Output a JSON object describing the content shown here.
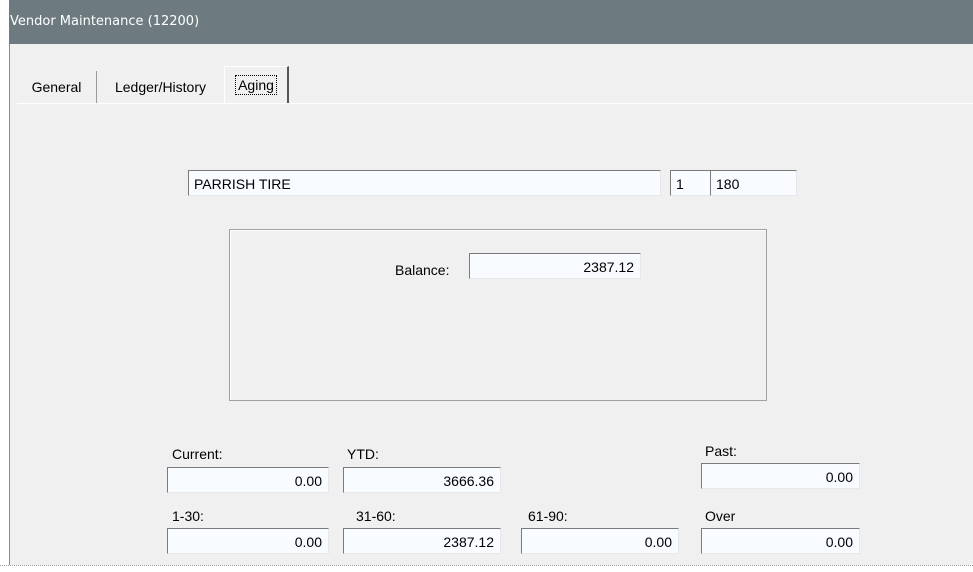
{
  "window": {
    "title": "Vendor Maintenance (12200)"
  },
  "tabs": [
    {
      "label": "General"
    },
    {
      "label": "Ledger/History"
    },
    {
      "label": "Aging"
    }
  ],
  "vendor": {
    "name": "PARRISH TIRE",
    "store": "1",
    "number": "180"
  },
  "balance": {
    "label": "Balance:",
    "value": "2387.12"
  },
  "aging": {
    "current": {
      "label": "Current:",
      "value": "0.00"
    },
    "ytd": {
      "label": "YTD:",
      "value": "3666.36"
    },
    "past": {
      "label": "Past:",
      "value": "0.00"
    },
    "d1_30": {
      "label": "1-30:",
      "value": "0.00"
    },
    "d31_60": {
      "label": "31-60:",
      "value": "2387.12"
    },
    "d61_90": {
      "label": "61-90:",
      "value": "0.00"
    },
    "over": {
      "label": "Over",
      "value": "0.00"
    }
  }
}
